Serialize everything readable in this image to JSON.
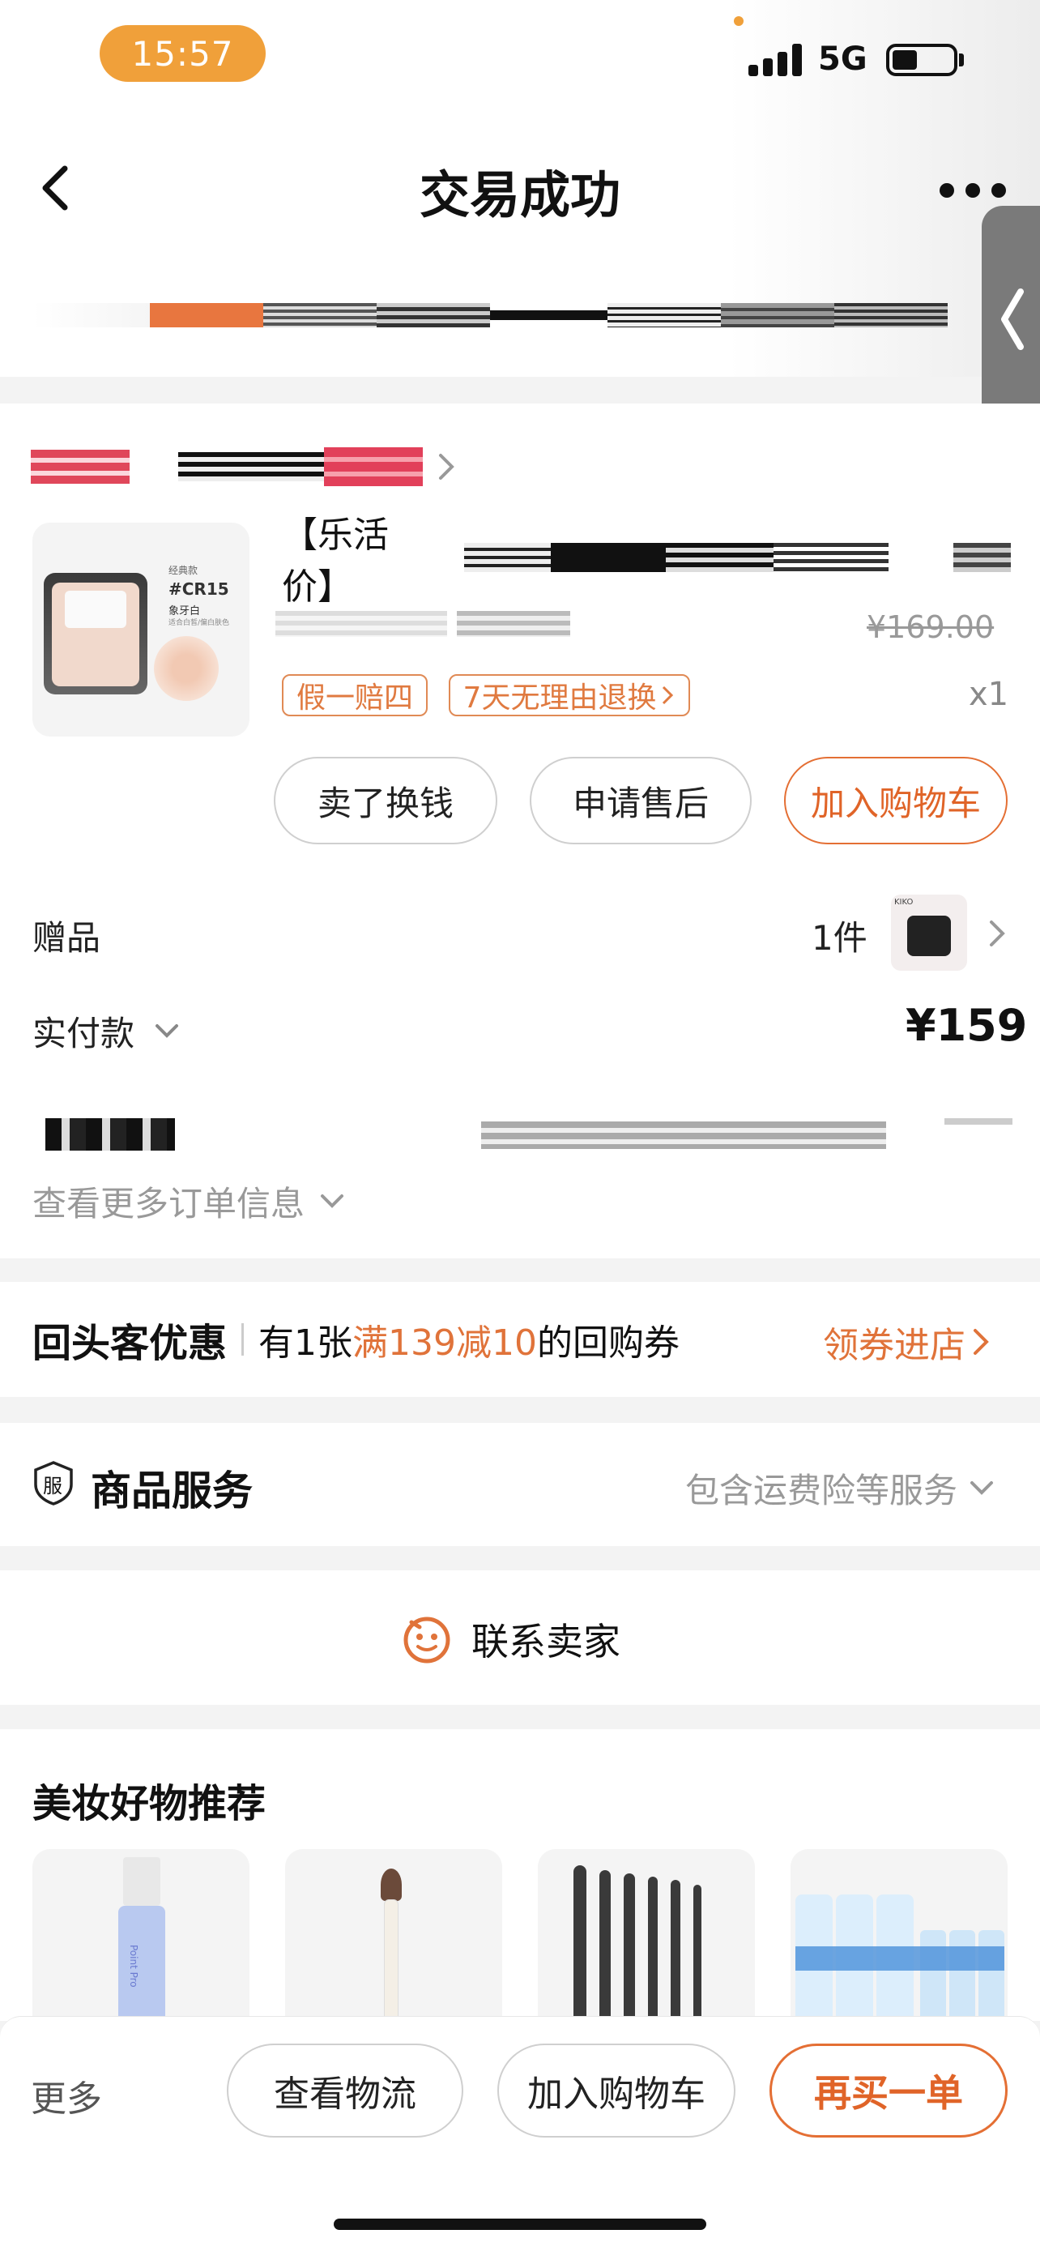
{
  "status_bar": {
    "time": "15:57",
    "network": "5G"
  },
  "nav": {
    "title": "交易成功"
  },
  "order": {
    "product_title": "【乐活价】",
    "original_price": "¥169.00",
    "quantity": "x1",
    "tags": [
      "假一赔四",
      "7天无理由退换"
    ],
    "product_thumb_text": [
      "经典款",
      "#CR15",
      "象牙白",
      "适合白皙/偏白肤色"
    ],
    "actions": [
      "卖了换钱",
      "申请售后",
      "加入购物车"
    ],
    "gift_label": "赠品",
    "gift_count": "1件",
    "gift_brand": "KIKO",
    "paid_label": "实付款",
    "paid_amount": "¥159",
    "more_info": "查看更多订单信息"
  },
  "returning": {
    "title": "回头客优惠",
    "text_prefix": "有1张",
    "highlight": "满139减10",
    "text_suffix": "的回购券",
    "action": "领券进店"
  },
  "service": {
    "badge": "服",
    "title": "商品服务",
    "summary": "包含运费险等服务"
  },
  "contact": {
    "label": "联系卖家"
  },
  "recommend": {
    "title": "美妆好物推荐",
    "item_text": "Point Pro"
  },
  "bottom_bar": {
    "more": "更多",
    "buttons": [
      "查看物流",
      "加入购物车",
      "再买一单"
    ]
  },
  "colors": {
    "accent": "#E0733A",
    "status_pill": "#F0A03A"
  }
}
